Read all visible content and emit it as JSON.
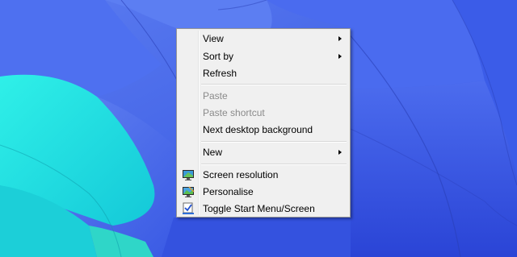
{
  "menu": {
    "view": "View",
    "sort_by": "Sort by",
    "refresh": "Refresh",
    "paste": "Paste",
    "paste_shortcut": "Paste shortcut",
    "next_background": "Next desktop background",
    "new": "New",
    "screen_resolution": "Screen resolution",
    "personalise": "Personalise",
    "toggle_start": "Toggle Start Menu/Screen"
  },
  "colors": {
    "menu_bg": "#f0f0f0",
    "menu_border": "#979797",
    "disabled_text": "#8a8a8a",
    "wallpaper_blue": "#3f63e6",
    "wallpaper_cyan": "#1fe3e3"
  },
  "icons": {
    "screen_resolution": "monitor-icon",
    "personalise": "personalise-monitor-icon",
    "toggle_start": "checkbox-icon"
  }
}
